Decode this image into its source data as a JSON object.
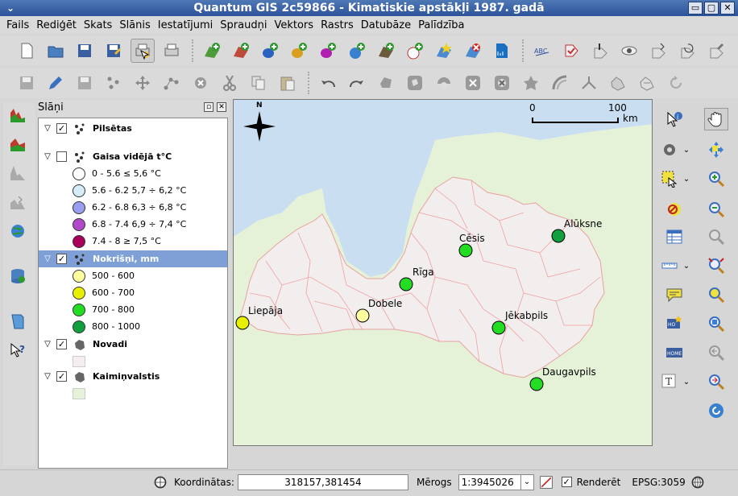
{
  "window": {
    "title": "Quantum GIS 2c59866 - Kimatiskie apstākļi 1987. gadā",
    "menu_glyph": "⌄",
    "buttons": [
      "▭",
      "▢",
      "✕"
    ]
  },
  "menu": [
    "Fails",
    "Rediģēt",
    "Skats",
    "Slānis",
    "Iestatījumi",
    "Spraudņi",
    "Vektors",
    "Rastrs",
    "Datubāze",
    "Palīdzība"
  ],
  "layers_panel": {
    "title": "Slāņi",
    "float_glyph": "▫",
    "close_glyph": "✕",
    "layers": [
      {
        "name": "Pilsētas",
        "checked": true
      },
      {
        "name": "Gaisa vidējā t°C",
        "checked": false,
        "classes": [
          {
            "label": "0 - 5.6 ≤ 5,6 °C",
            "color": "#ffffff"
          },
          {
            "label": "5.6 - 6.2 5,7 ÷ 6,2 °C",
            "color": "#d6ecf8"
          },
          {
            "label": "6.2 - 6.8 6,3 ÷ 6,8 °C",
            "color": "#9a9ef0"
          },
          {
            "label": "6.8 - 7.4 6,9 ÷ 7,4 °C",
            "color": "#b04ac8"
          },
          {
            "label": "7.4 - 8 ≥ 7,5 °C",
            "color": "#a8005a"
          }
        ]
      },
      {
        "name": "Nokrišņi, mm",
        "checked": true,
        "selected": true,
        "classes": [
          {
            "label": "500 - 600",
            "color": "#ffffa0"
          },
          {
            "label": "600 - 700",
            "color": "#e6f000"
          },
          {
            "label": "700 - 800",
            "color": "#22dd22"
          },
          {
            "label": "800 - 1000",
            "color": "#10a040"
          }
        ]
      },
      {
        "name": "Novadi",
        "checked": true,
        "swatch": "#f4eeee"
      },
      {
        "name": "Kaimiņvalstis",
        "checked": true,
        "swatch": "#e6f2d8"
      }
    ],
    "expand_glyph": "▽",
    "check_glyph": "✓"
  },
  "map": {
    "north_label": "N",
    "scalebar": {
      "start": "0",
      "end": "100",
      "unit": "km"
    },
    "colors": {
      "sea": "#c9dff1",
      "neighbors": "#e6f2d8",
      "latvia": "#f2eeee",
      "borders": "#f1a0a0"
    },
    "cities": [
      {
        "name": "Alūksne",
        "color": "#10a040"
      },
      {
        "name": "Cēsis",
        "color": "#22dd22"
      },
      {
        "name": "Rīga",
        "color": "#22dd22"
      },
      {
        "name": "Dobele",
        "color": "#ffffa0"
      },
      {
        "name": "Liepāja",
        "color": "#e6f000"
      },
      {
        "name": "Jēkabpils",
        "color": "#22dd22"
      },
      {
        "name": "Daugavpils",
        "color": "#22dd22"
      }
    ]
  },
  "status": {
    "coord_label": "Koordinātas:",
    "coord_value": "318157,381454",
    "scale_label": "Mērogs",
    "scale_value": "1:3945026",
    "dropdown_glyph": "⌄",
    "render_label": "Renderēt",
    "render_checked": true,
    "crs": "EPSG:3059"
  }
}
